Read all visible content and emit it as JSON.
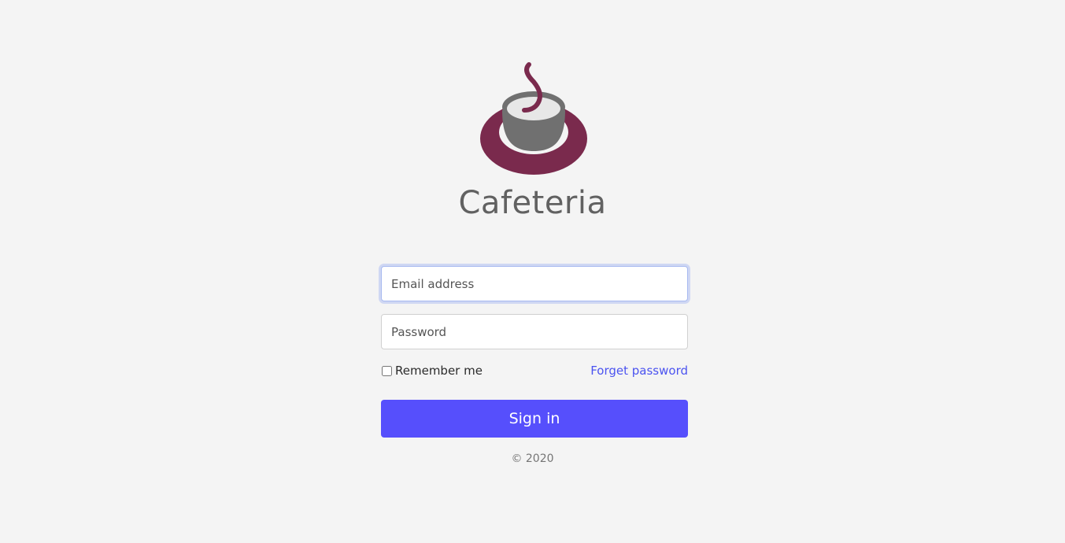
{
  "brand": {
    "name": "Cafeteria",
    "logo_icon": "coffee-cup-logo-icon",
    "colors": {
      "saucer": "#7a2a4d",
      "cup": "#707070",
      "steam": "#7a2a4d"
    }
  },
  "form": {
    "email_placeholder": "Email address",
    "email_value": "",
    "password_placeholder": "Password",
    "password_value": "",
    "remember_label": "Remember me",
    "remember_checked": false,
    "forgot_label": "Forget password",
    "submit_label": "Sign in"
  },
  "footer": {
    "copyright": "© 2020"
  },
  "theme": {
    "accent": "#564ffc",
    "link": "#4b53f0",
    "background": "#f4f4f4"
  }
}
